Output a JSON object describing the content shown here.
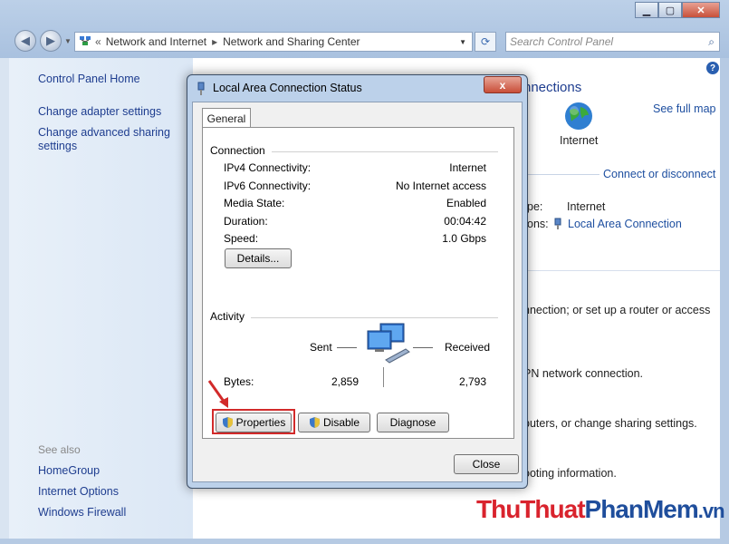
{
  "explorer": {
    "breadcrumb": [
      "Network and Internet",
      "Network and Sharing Center"
    ],
    "search_placeholder": "Search Control Panel"
  },
  "left_pane": {
    "links": [
      "Control Panel Home",
      "Change adapter settings",
      "Change advanced sharing settings"
    ],
    "see_also_label": "See also",
    "see_also_links": [
      "HomeGroup",
      "Internet Options",
      "Windows Firewall"
    ]
  },
  "main_pane": {
    "heading_fragment": "nnections",
    "see_full_map": "See full map",
    "internet_label": "Internet",
    "connect_or_disconnect": "Connect or disconnect",
    "access_type_label": "pe:",
    "access_type_value": "Internet",
    "connections_label": "ons:",
    "connections_value": "Local Area Connection",
    "task1": "nnection; or set up a router or access",
    "task2": "PN network connection.",
    "task3": "puters, or change sharing settings.",
    "task4": "ooting information."
  },
  "dialog": {
    "title": "Local Area Connection Status",
    "close_glyph": "x",
    "tab": "General",
    "connection_section": "Connection",
    "rows": [
      {
        "label": "IPv4 Connectivity:",
        "value": "Internet"
      },
      {
        "label": "IPv6 Connectivity:",
        "value": "No Internet access"
      },
      {
        "label": "Media State:",
        "value": "Enabled"
      },
      {
        "label": "Duration:",
        "value": "00:04:42"
      },
      {
        "label": "Speed:",
        "value": "1.0 Gbps"
      }
    ],
    "details_button": "Details...",
    "activity_section": "Activity",
    "sent_label": "Sent",
    "received_label": "Received",
    "bytes_label": "Bytes:",
    "bytes_sent": "2,859",
    "bytes_received": "2,793",
    "properties_button": "Properties",
    "disable_button": "Disable",
    "diagnose_button": "Diagnose",
    "close_button": "Close"
  },
  "watermark": {
    "part1": "ThuThuat",
    "part2": "PhanMem",
    "part3": ".vn"
  },
  "colors": {
    "link": "#1e3d8f",
    "highlight": "#d22a2a",
    "watermark_red": "#d9232d",
    "watermark_blue": "#1f4e9c"
  }
}
